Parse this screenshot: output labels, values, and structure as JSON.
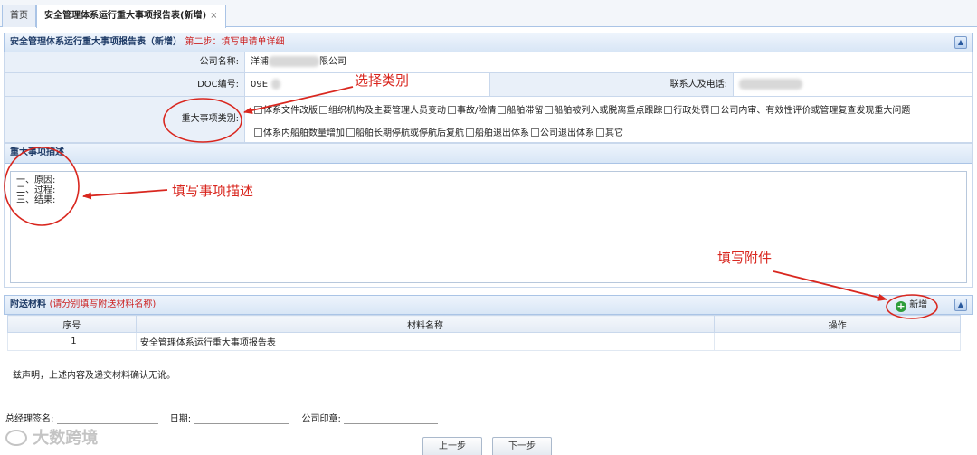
{
  "tabs": [
    {
      "label": "首页"
    },
    {
      "label": "安全管理体系运行重大事项报告表(新增)",
      "close": "×"
    }
  ],
  "form_panel": {
    "title": "安全管理体系运行重大事项报告表（新增）",
    "step": "第二步：填写申请单详细"
  },
  "fields": {
    "company_label": "公司名称:",
    "company_value_prefix": "洋浦",
    "company_value_suffix": "限公司",
    "doc_label": "DOC编号:",
    "doc_value": "09E",
    "contact_label": "联系人及电话:",
    "category_label": "重大事项类别:"
  },
  "categories_row1": [
    "体系文件改版",
    "组织机构及主要管理人员变动",
    "事故/险情",
    "船舶滞留",
    "船舶被列入或脱离重点跟踪",
    "行政处罚",
    "公司内审、有效性评价或管理复查发现重大问题"
  ],
  "categories_row2": [
    "体系内船舶数量增加",
    "船舶长期停航或停航后复航",
    "船舶退出体系",
    "公司退出体系",
    "其它"
  ],
  "description": {
    "title": "重大事项描述",
    "lines": [
      "一、原因:",
      "二、过程:",
      "三、结果:"
    ]
  },
  "attachments": {
    "title": "附送材料",
    "hint": "(请分别填写附送材料名称)",
    "add_label": "新增",
    "columns": [
      "序号",
      "材料名称",
      "操作"
    ],
    "rows": [
      {
        "index": "1",
        "name": "安全管理体系运行重大事项报告表",
        "action": ""
      }
    ]
  },
  "declaration": "兹声明，上述内容及递交材料确认无讹。",
  "signature": {
    "manager_label": "总经理签名:",
    "date_label": "日期:",
    "seal_label": "公司印章:"
  },
  "buttons": {
    "prev": "上一步",
    "next": "下一步"
  },
  "annotations": {
    "select_category": "选择类别",
    "fill_description": "填写事项描述",
    "fill_attachment": "填写附件"
  },
  "watermark": "大数跨境",
  "colors": {
    "annotation_red": "#d9271f",
    "header_blue": "#1d3a66",
    "add_icon_green": "#2e9e3a"
  }
}
